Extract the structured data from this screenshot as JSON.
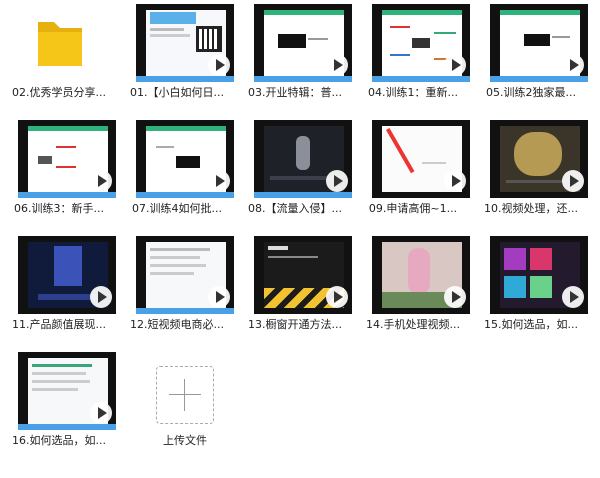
{
  "items": [
    {
      "type": "folder",
      "label": "02.优秀学员分享..."
    },
    {
      "type": "video",
      "label": "01.【小白如何日...",
      "style": "web"
    },
    {
      "type": "video",
      "label": "03.开业特辑：普...",
      "style": "logo"
    },
    {
      "type": "video",
      "label": "04.训练1：重新...",
      "style": "mindmap"
    },
    {
      "type": "video",
      "label": "05.训练2独家最...",
      "style": "logo"
    },
    {
      "type": "video",
      "label": "06.训练3：新手...",
      "style": "mindmap"
    },
    {
      "type": "video",
      "label": "07.训练4如何批...",
      "style": "logo"
    },
    {
      "type": "video",
      "label": "08.【流量入侵】...",
      "style": "dark"
    },
    {
      "type": "video",
      "label": "09.申请高佣~1...",
      "style": "red"
    },
    {
      "type": "video",
      "label": "10.视频处理，还...",
      "style": "photo"
    },
    {
      "type": "video",
      "label": "11.产品颜值展现...",
      "style": "darkblue"
    },
    {
      "type": "video",
      "label": "12.短视频电商必...",
      "style": "web"
    },
    {
      "type": "video",
      "label": "13.橱窗开通方法...",
      "style": "yellow"
    },
    {
      "type": "video",
      "label": "14.手机处理视频...",
      "style": "pink"
    },
    {
      "type": "video",
      "label": "15.如何选品，如...",
      "style": "purple"
    },
    {
      "type": "video",
      "label": "16.如何选品，如...",
      "style": "web"
    },
    {
      "type": "upload",
      "label": "上传文件"
    }
  ],
  "colors": {
    "folder": "#f5c518",
    "folder_tab": "#e6b10f",
    "accent_green": "#2fb37d",
    "accent_blue": "#4aa0e6"
  }
}
